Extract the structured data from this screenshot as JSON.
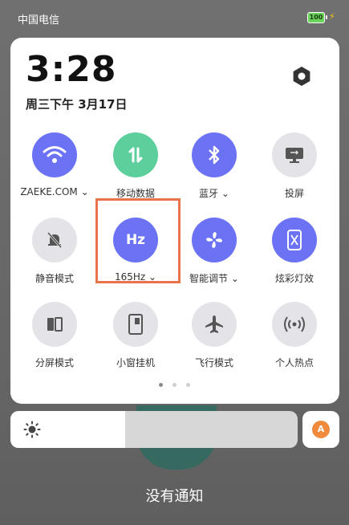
{
  "status_bar": {
    "carrier": "中国电信",
    "battery_level": "100"
  },
  "panel": {
    "time": "3:28",
    "date": "周三下午 3月17日",
    "tiles": [
      {
        "label": "ZAEKE.COM",
        "icon": "wifi-icon",
        "state": "on-blue"
      },
      {
        "label": "移动数据",
        "icon": "mobile-data-icon",
        "state": "on-green"
      },
      {
        "label": "蓝牙",
        "icon": "bluetooth-icon",
        "state": "on-blue"
      },
      {
        "label": "投屏",
        "icon": "screencast-icon",
        "state": "off"
      },
      {
        "label": "静音模式",
        "icon": "mute-bell-icon",
        "state": "off"
      },
      {
        "label": "165Hz",
        "icon_text": "Hz",
        "icon": "refresh-rate-icon",
        "state": "on-blue"
      },
      {
        "label": "智能调节",
        "icon": "fan-icon",
        "state": "on-blue"
      },
      {
        "label": "炫彩灯效",
        "icon": "light-effect-icon",
        "state": "on-blue"
      },
      {
        "label": "分屏模式",
        "icon": "split-screen-icon",
        "state": "off"
      },
      {
        "label": "小窗挂机",
        "icon": "small-window-icon",
        "state": "off"
      },
      {
        "label": "飞行模式",
        "icon": "airplane-icon",
        "state": "off"
      },
      {
        "label": "个人热点",
        "icon": "hotspot-icon",
        "state": "off"
      }
    ],
    "page_dots": 3,
    "active_page": 1
  },
  "brightness": {
    "level": 0.4
  },
  "auto_brightness_label": "A",
  "notifications": {
    "empty_text": "没有通知"
  },
  "colors": {
    "accent_blue": "#6b73f4",
    "accent_green": "#5dcf9c",
    "highlight": "#e8734a"
  }
}
